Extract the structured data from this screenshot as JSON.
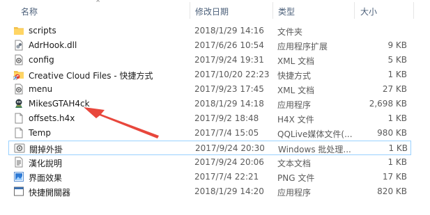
{
  "columns": {
    "name": "名称",
    "date": "修改日期",
    "type": "类型",
    "size": "大小"
  },
  "files": [
    {
      "name": "scripts",
      "date": "2018/1/29 14:16",
      "type": "文件夹",
      "size": "",
      "icon": "folder-icon"
    },
    {
      "name": "AdrHook.dll",
      "date": "2017/6/26 10:54",
      "type": "应用程序扩展",
      "size": "9 KB",
      "icon": "dll-file-icon"
    },
    {
      "name": "config",
      "date": "2017/9/24 19:31",
      "type": "XML 文档",
      "size": "5 KB",
      "icon": "xml-file-icon"
    },
    {
      "name": "Creative Cloud Files - 快捷方式",
      "date": "2017/10/20 22:23",
      "type": "快捷方式",
      "size": "1 KB",
      "icon": "shortcut-folder-icon"
    },
    {
      "name": "menu",
      "date": "2017/9/23 17:45",
      "type": "XML 文档",
      "size": "27 KB",
      "icon": "xml-file-icon"
    },
    {
      "name": "MikesGTAH4ck",
      "date": "2018/1/29 14:18",
      "type": "应用程序",
      "size": "2,698 KB",
      "icon": "application-icon"
    },
    {
      "name": "offsets.h4x",
      "date": "2017/9/2 18:48",
      "type": "H4X 文件",
      "size": "1 KB",
      "icon": "blank-file-icon"
    },
    {
      "name": "Temp",
      "date": "2017/7/4 15:05",
      "type": "QQLive媒体文件(...",
      "size": "980 KB",
      "icon": "blank-file-icon"
    },
    {
      "name": "關掉外掛",
      "date": "2017/9/24 20:30",
      "type": "Windows 批处理...",
      "size": "1 KB",
      "icon": "batch-file-icon"
    },
    {
      "name": "漢化說明",
      "date": "2017/9/24 20:06",
      "type": "文本文档",
      "size": "1 KB",
      "icon": "text-file-icon"
    },
    {
      "name": "界面效果",
      "date": "2017/7/4 22:21",
      "type": "PNG 文件",
      "size": "17 KB",
      "icon": "png-file-icon"
    },
    {
      "name": "快捷開關器",
      "date": "2018/1/29 14:20",
      "type": "应用程序",
      "size": "820 KB",
      "icon": "app-window-icon"
    }
  ],
  "selected_index": 8,
  "annotation_color": "#e8473c"
}
